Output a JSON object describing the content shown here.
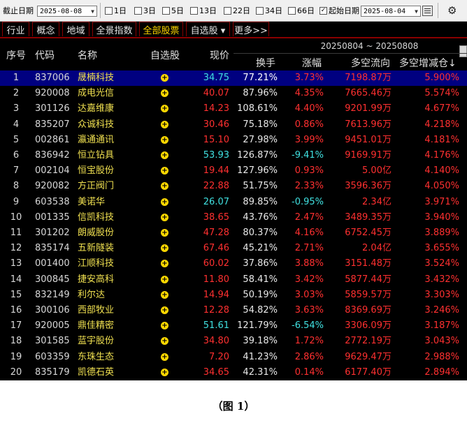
{
  "toolbar": {
    "end_date_label": "截止日期",
    "end_date_value": "2025-08-08",
    "checkboxes": [
      {
        "label": "1日",
        "checked": false
      },
      {
        "label": "3日",
        "checked": false
      },
      {
        "label": "5日",
        "checked": false
      },
      {
        "label": "13日",
        "checked": false
      },
      {
        "label": "22日",
        "checked": false
      },
      {
        "label": "34日",
        "checked": false
      },
      {
        "label": "66日",
        "checked": false
      },
      {
        "label": "起始日期",
        "checked": true
      }
    ],
    "start_date_value": "2025-08-04",
    "calendar_icon": "calendar-icon",
    "settings_icon": "gear-icon"
  },
  "tabs": [
    "行业",
    "概念",
    "地域",
    "全景指数",
    "全部股票",
    "自选股 ▾",
    "更多>>"
  ],
  "active_tab": "全部股票",
  "table": {
    "headers": {
      "seq": "序号",
      "code": "代码",
      "name": "名称",
      "watch": "自选股",
      "price": "现价",
      "turnover": "换手",
      "change": "涨幅",
      "flow": "多空流向",
      "flow_change": "多空增减仓↓"
    },
    "date_range": "20250804 ~ 20250808",
    "rows": [
      {
        "seq": "1",
        "code": "837006",
        "name": "晟楠科技",
        "price": "34.75",
        "turnover": "77.21%",
        "change": "3.73%",
        "flow": "7198.87",
        "unit": "万",
        "pct": "5.900%",
        "dir": "up"
      },
      {
        "seq": "2",
        "code": "920008",
        "name": "成电光信",
        "price": "40.07",
        "turnover": "87.96%",
        "change": "4.35%",
        "flow": "7665.46",
        "unit": "万",
        "pct": "5.574%",
        "dir": "up"
      },
      {
        "seq": "3",
        "code": "301126",
        "name": "达嘉维康",
        "price": "14.23",
        "turnover": "108.61%",
        "change": "4.40%",
        "flow": "9201.99",
        "unit": "万",
        "pct": "4.677%",
        "dir": "up"
      },
      {
        "seq": "4",
        "code": "835207",
        "name": "众诚科技",
        "price": "30.46",
        "turnover": "75.18%",
        "change": "0.86%",
        "flow": "7613.96",
        "unit": "万",
        "pct": "4.218%",
        "dir": "up"
      },
      {
        "seq": "5",
        "code": "002861",
        "name": "瀛通通讯",
        "price": "15.10",
        "turnover": "27.98%",
        "change": "3.99%",
        "flow": "9451.01",
        "unit": "万",
        "pct": "4.181%",
        "dir": "up"
      },
      {
        "seq": "6",
        "code": "836942",
        "name": "恒立钻具",
        "price": "53.93",
        "turnover": "126.87%",
        "change": "-9.41%",
        "flow": "9169.91",
        "unit": "万",
        "pct": "4.176%",
        "dir": "down"
      },
      {
        "seq": "7",
        "code": "002104",
        "name": "恒宝股份",
        "price": "19.44",
        "turnover": "127.96%",
        "change": "0.93%",
        "flow": "5.00",
        "unit": "亿",
        "pct": "4.140%",
        "dir": "up"
      },
      {
        "seq": "8",
        "code": "920082",
        "name": "方正阀门",
        "price": "22.88",
        "turnover": "51.75%",
        "change": "2.33%",
        "flow": "3596.36",
        "unit": "万",
        "pct": "4.050%",
        "dir": "up"
      },
      {
        "seq": "9",
        "code": "603538",
        "name": "美诺华",
        "price": "26.07",
        "turnover": "89.85%",
        "change": "-0.95%",
        "flow": "2.34",
        "unit": "亿",
        "pct": "3.971%",
        "dir": "down"
      },
      {
        "seq": "10",
        "code": "001335",
        "name": "信凯科技",
        "price": "38.65",
        "turnover": "43.76%",
        "change": "2.47%",
        "flow": "3489.35",
        "unit": "万",
        "pct": "3.940%",
        "dir": "up"
      },
      {
        "seq": "11",
        "code": "301202",
        "name": "朗威股份",
        "price": "47.28",
        "turnover": "80.37%",
        "change": "4.16%",
        "flow": "6752.45",
        "unit": "万",
        "pct": "3.889%",
        "dir": "up"
      },
      {
        "seq": "12",
        "code": "835174",
        "name": "五新隧装",
        "price": "67.46",
        "turnover": "45.21%",
        "change": "2.71%",
        "flow": "2.04",
        "unit": "亿",
        "pct": "3.655%",
        "dir": "up"
      },
      {
        "seq": "13",
        "code": "001400",
        "name": "江顺科技",
        "price": "60.02",
        "turnover": "37.86%",
        "change": "3.88%",
        "flow": "3151.48",
        "unit": "万",
        "pct": "3.524%",
        "dir": "up"
      },
      {
        "seq": "14",
        "code": "300845",
        "name": "捷安高科",
        "price": "11.80",
        "turnover": "58.41%",
        "change": "3.42%",
        "flow": "5877.44",
        "unit": "万",
        "pct": "3.432%",
        "dir": "up"
      },
      {
        "seq": "15",
        "code": "832149",
        "name": "利尔达",
        "price": "14.94",
        "turnover": "50.19%",
        "change": "3.03%",
        "flow": "5859.57",
        "unit": "万",
        "pct": "3.303%",
        "dir": "up"
      },
      {
        "seq": "16",
        "code": "300106",
        "name": "西部牧业",
        "price": "12.28",
        "turnover": "54.82%",
        "change": "3.63%",
        "flow": "8369.69",
        "unit": "万",
        "pct": "3.246%",
        "dir": "up"
      },
      {
        "seq": "17",
        "code": "920005",
        "name": "鼎佳精密",
        "price": "51.61",
        "turnover": "121.79%",
        "change": "-6.54%",
        "flow": "3306.09",
        "unit": "万",
        "pct": "3.187%",
        "dir": "down"
      },
      {
        "seq": "18",
        "code": "301585",
        "name": "蓝宇股份",
        "price": "34.80",
        "turnover": "39.18%",
        "change": "1.72%",
        "flow": "2772.19",
        "unit": "万",
        "pct": "3.043%",
        "dir": "up"
      },
      {
        "seq": "19",
        "code": "603359",
        "name": "东珠生态",
        "price": "7.20",
        "turnover": "41.23%",
        "change": "2.86%",
        "flow": "9629.47",
        "unit": "万",
        "pct": "2.988%",
        "dir": "up"
      },
      {
        "seq": "20",
        "code": "835179",
        "name": "凯德石英",
        "price": "34.65",
        "turnover": "42.31%",
        "change": "0.14%",
        "flow": "6177.40",
        "unit": "万",
        "pct": "2.894%",
        "dir": "up"
      }
    ],
    "selected_row": 0,
    "add_icon": "plus-circle-icon"
  },
  "caption": "（图 1）",
  "colors": {
    "up": "#ff3030",
    "down": "#40e0e0",
    "name": "#f0e050",
    "selected": "#000080",
    "accent": "#ffd800"
  }
}
